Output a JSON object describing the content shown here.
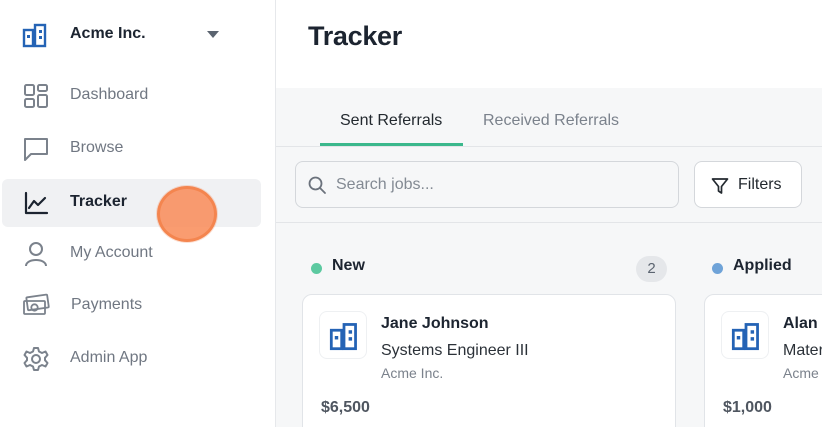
{
  "org": {
    "name": "Acme Inc.",
    "logo_icon": "building-icon",
    "menu_icon": "caret-down-icon"
  },
  "sidebar": {
    "items": [
      {
        "label": "Dashboard",
        "icon": "dashboard-grid-icon",
        "active": false
      },
      {
        "label": "Browse",
        "icon": "chat-bubble-icon",
        "active": false
      },
      {
        "label": "Tracker",
        "icon": "line-chart-icon",
        "active": true
      },
      {
        "label": "My Account",
        "icon": "user-icon",
        "active": false
      },
      {
        "label": "Payments",
        "icon": "money-icon",
        "active": false
      },
      {
        "label": "Admin App",
        "icon": "gear-icon",
        "active": false
      }
    ]
  },
  "main": {
    "title": "Tracker",
    "tabs": [
      {
        "label": "Sent Referrals",
        "active": true
      },
      {
        "label": "Received Referrals",
        "active": false
      }
    ],
    "search": {
      "placeholder": "Search jobs...",
      "value": ""
    },
    "filters_label": "Filters",
    "columns": [
      {
        "title": "New",
        "count": "2",
        "color": "#5cc9a0",
        "cards": [
          {
            "name": "Jane Johnson",
            "role": "Systems Engineer III",
            "company": "Acme Inc.",
            "amount": "$6,500"
          }
        ]
      },
      {
        "title": "Applied",
        "count": "",
        "color": "#6fa3d8",
        "cards": [
          {
            "name": "Alan T",
            "role": "Mater",
            "company": "Acme",
            "amount": "$1,000"
          }
        ]
      }
    ]
  },
  "colors": {
    "accent_green": "#3bb88c",
    "brand_blue": "#2463b5",
    "cursor": "#f4854f"
  }
}
